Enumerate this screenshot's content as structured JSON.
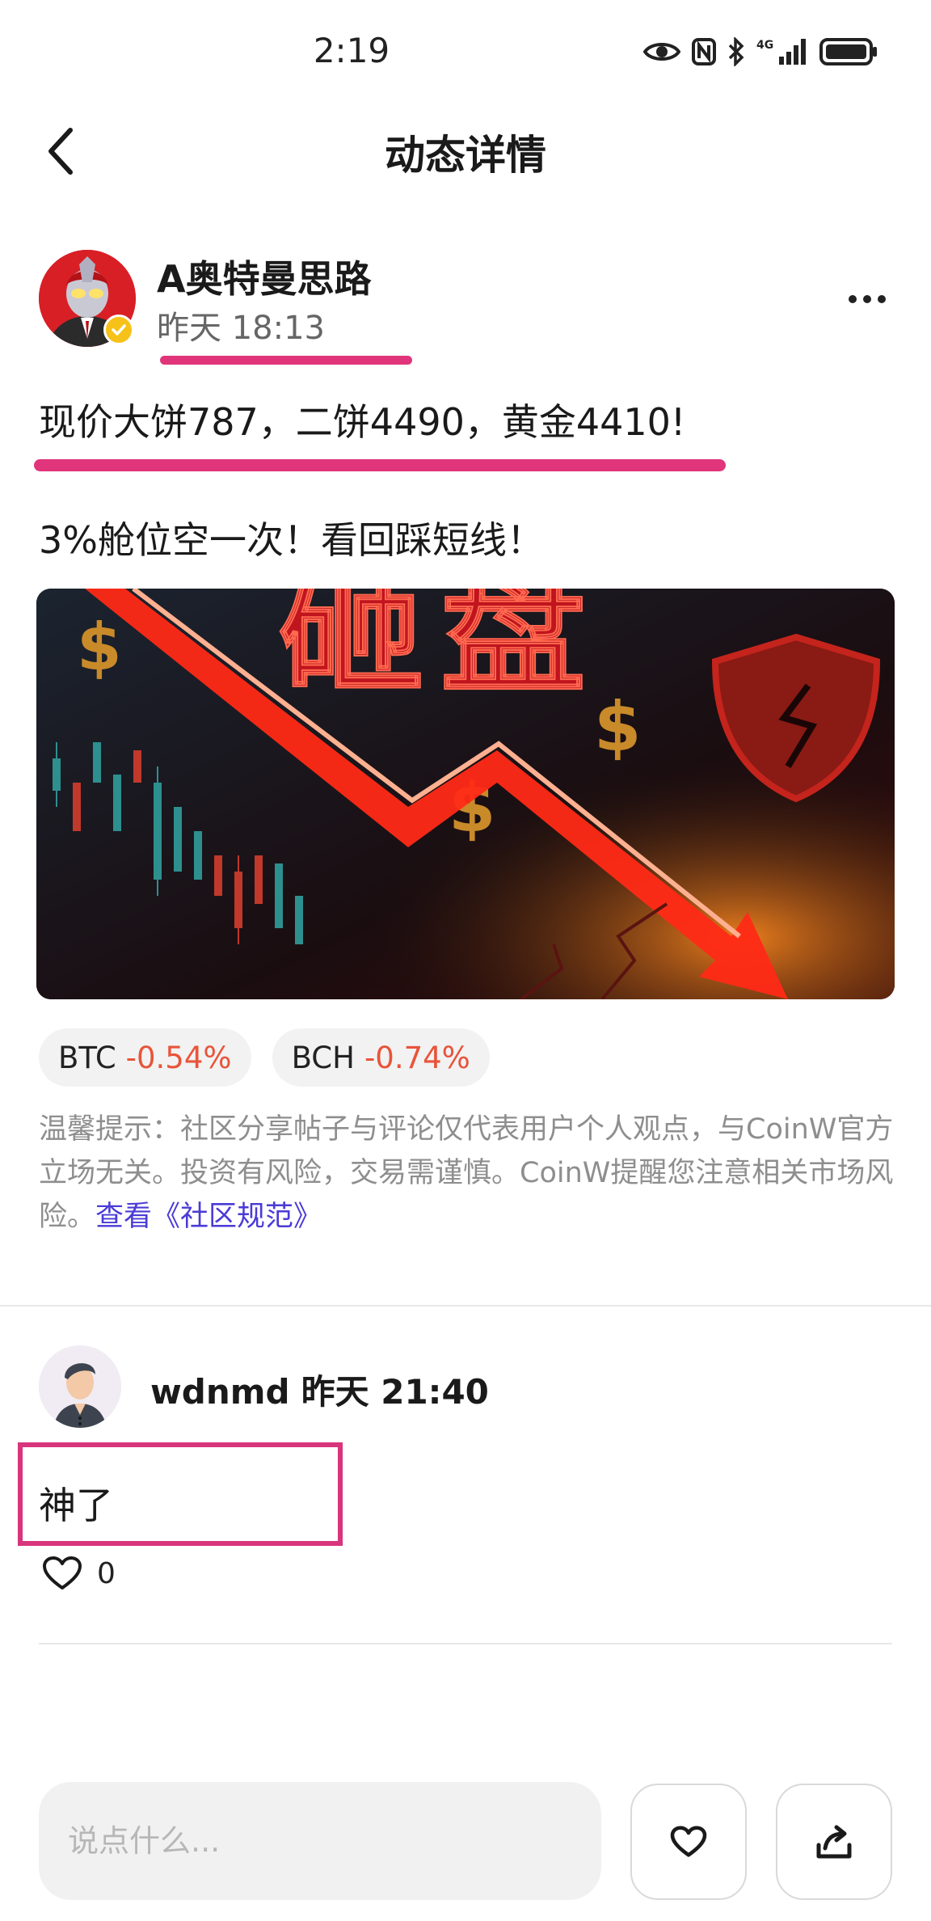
{
  "status_bar": {
    "time": "2:19",
    "icons": [
      "eye-icon",
      "nfc-icon",
      "bluetooth-icon",
      "signal-4g-icon",
      "battery-icon"
    ],
    "network_label": "4G"
  },
  "header": {
    "title": "动态详情",
    "back_icon": "chevron-left-icon"
  },
  "post": {
    "author": {
      "name": "A奥特曼思路",
      "verified": true
    },
    "time": "昨天 18:13",
    "text_line1": "现价大饼787，二饼4490，黄金4410!",
    "text_line2": "3%舱位空一次！看回踩短线！",
    "image": {
      "headline": "砸盘",
      "colors": {
        "background": "#140a0c",
        "arrow": "#ff3b1f",
        "text": "#c0151e"
      }
    },
    "coin_tags": [
      {
        "symbol": "BTC",
        "change": "-0.54%"
      },
      {
        "symbol": "BCH",
        "change": "-0.74%"
      }
    ],
    "disclaimer": "温馨提示：社区分享帖子与评论仅代表用户个人观点，与CoinW官方立场无关。投资有风险，交易需谨慎。CoinW提醒您注意相关市场风险。",
    "disclaimer_link": "查看《社区规范》"
  },
  "comments": [
    {
      "user": "wdnmd",
      "time": "昨天 21:40",
      "text": "神了",
      "likes": "0"
    }
  ],
  "bottom_bar": {
    "placeholder": "说点什么...",
    "like_icon": "heart-icon",
    "share_icon": "share-icon"
  },
  "colors": {
    "accent_highlight": "#e0357a",
    "negative": "#e8543a",
    "link": "#4a3bd6",
    "muted_text": "#8e8e8e"
  }
}
